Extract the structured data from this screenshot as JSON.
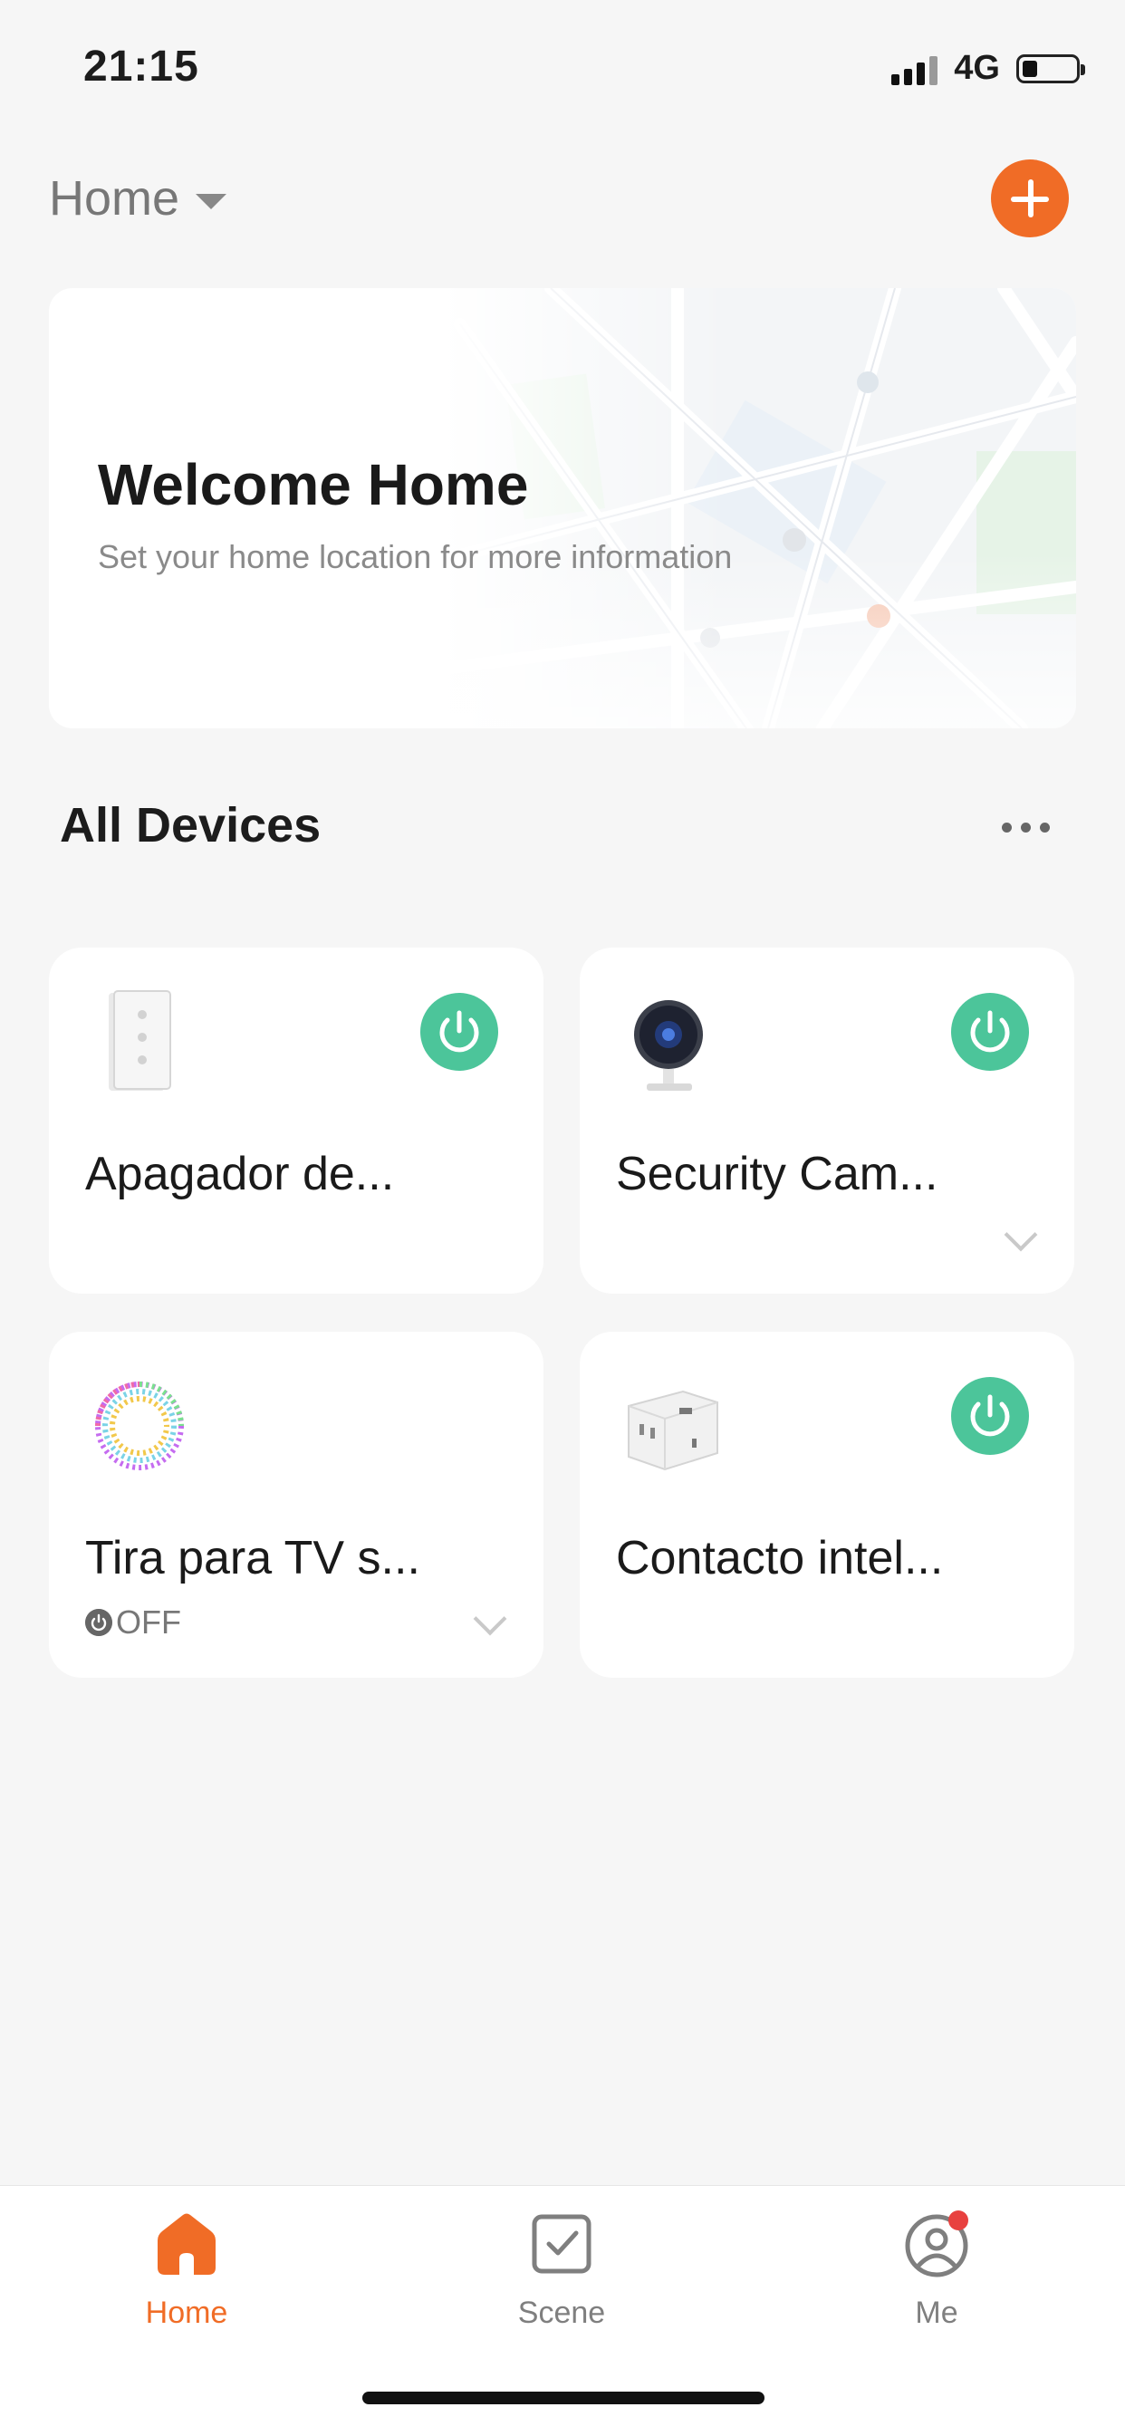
{
  "status_bar": {
    "time": "21:15",
    "network": "4G"
  },
  "header": {
    "home_label": "Home",
    "add_icon": "plus-icon"
  },
  "welcome_card": {
    "title": "Welcome Home",
    "subtitle": "Set your home location for more information"
  },
  "devices_section": {
    "title": "All Devices"
  },
  "devices": [
    {
      "name": "Apagador de...",
      "icon": "wall-switch-icon",
      "power_on": true
    },
    {
      "name": "Security Cam...",
      "icon": "camera-icon",
      "power_on": true
    },
    {
      "name": "Tira para TV s...",
      "icon": "light-strip-icon",
      "state": "OFF"
    },
    {
      "name": "Contacto intel...",
      "icon": "smart-plug-icon",
      "power_on": true
    }
  ],
  "tabbar": {
    "tabs": [
      {
        "label": "Home",
        "icon": "home-icon",
        "active": true
      },
      {
        "label": "Scene",
        "icon": "scene-check-icon",
        "active": false
      },
      {
        "label": "Me",
        "icon": "profile-icon",
        "active": false,
        "badge": true
      }
    ]
  },
  "colors": {
    "accent": "#f06c26",
    "power_on": "#4cc59a",
    "badge": "#e8413f",
    "inactive_tab": "#7f7f7f"
  }
}
